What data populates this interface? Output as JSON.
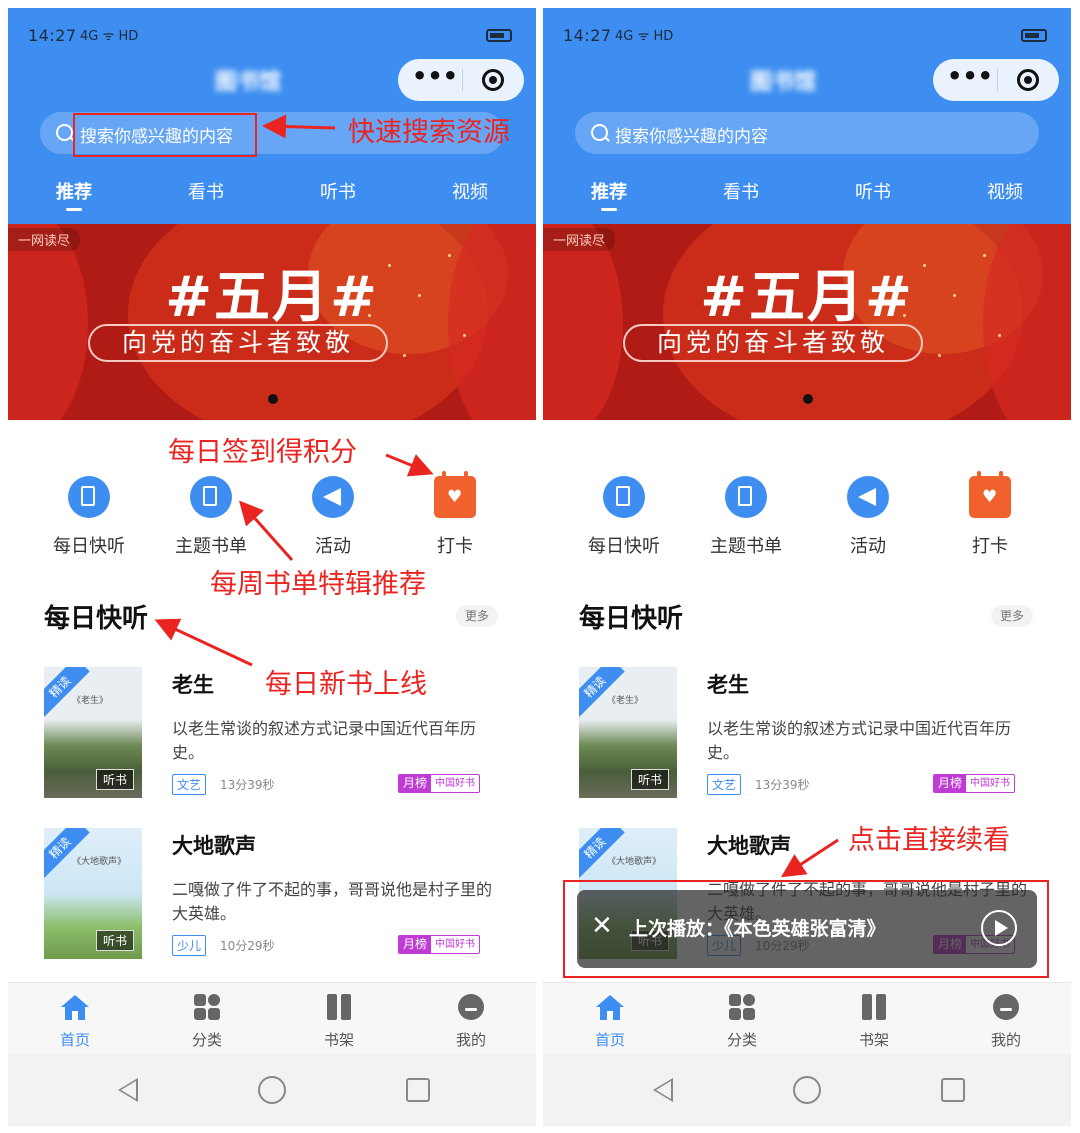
{
  "status": {
    "time": "14:27",
    "signal": "4G ᯤ HD"
  },
  "app": {
    "title": "图书馆",
    "capsule_more": "•••"
  },
  "search": {
    "placeholder": "搜索你感兴趣的内容"
  },
  "tabs": [
    "推荐",
    "看书",
    "听书",
    "视频"
  ],
  "banner": {
    "tag": "一网读尽",
    "title": "#五月#",
    "subtitle": "向党的奋斗者致敬"
  },
  "quick": [
    {
      "label": "每日快听",
      "icon": "headphone-book-icon"
    },
    {
      "label": "主题书单",
      "icon": "book-list-icon"
    },
    {
      "label": "活动",
      "icon": "megaphone-icon"
    },
    {
      "label": "打卡",
      "icon": "calendar-heart-icon"
    }
  ],
  "section": {
    "title": "每日快听",
    "more": "更多"
  },
  "books": [
    {
      "ribbon": "精读",
      "cover_title": "《老生》",
      "badge": "听书",
      "name": "老生",
      "desc": "以老生常谈的叙述方式记录中国近代百年历史。",
      "category": "文艺",
      "duration": "13分39秒",
      "rank": "月榜",
      "rank_sub": "中国好书"
    },
    {
      "ribbon": "精读",
      "cover_title": "《大地歌声》",
      "badge": "听书",
      "name": "大地歌声",
      "desc": "二嘎做了件了不起的事，哥哥说他是村子里的大英雄。",
      "category": "少儿",
      "duration": "10分29秒",
      "rank": "月榜",
      "rank_sub": "中国好书"
    }
  ],
  "tabbar": [
    {
      "label": "首页",
      "icon": "home-icon"
    },
    {
      "label": "分类",
      "icon": "category-icon"
    },
    {
      "label": "书架",
      "icon": "bookshelf-icon"
    },
    {
      "label": "我的",
      "icon": "profile-icon"
    }
  ],
  "player": {
    "text": "上次播放：《本色英雄张富清》"
  },
  "annotations": {
    "search": "快速搜索资源",
    "checkin": "每日签到得积分",
    "booklist": "每周书单特辑推荐",
    "daily": "每日新书上线",
    "resume": "点击直接续看"
  },
  "colors": {
    "primary": "#3d8ef0",
    "annotation": "#ea2421",
    "banner": "#b11b15",
    "checkin": "#f0612e",
    "rank": "#c03bd4"
  }
}
